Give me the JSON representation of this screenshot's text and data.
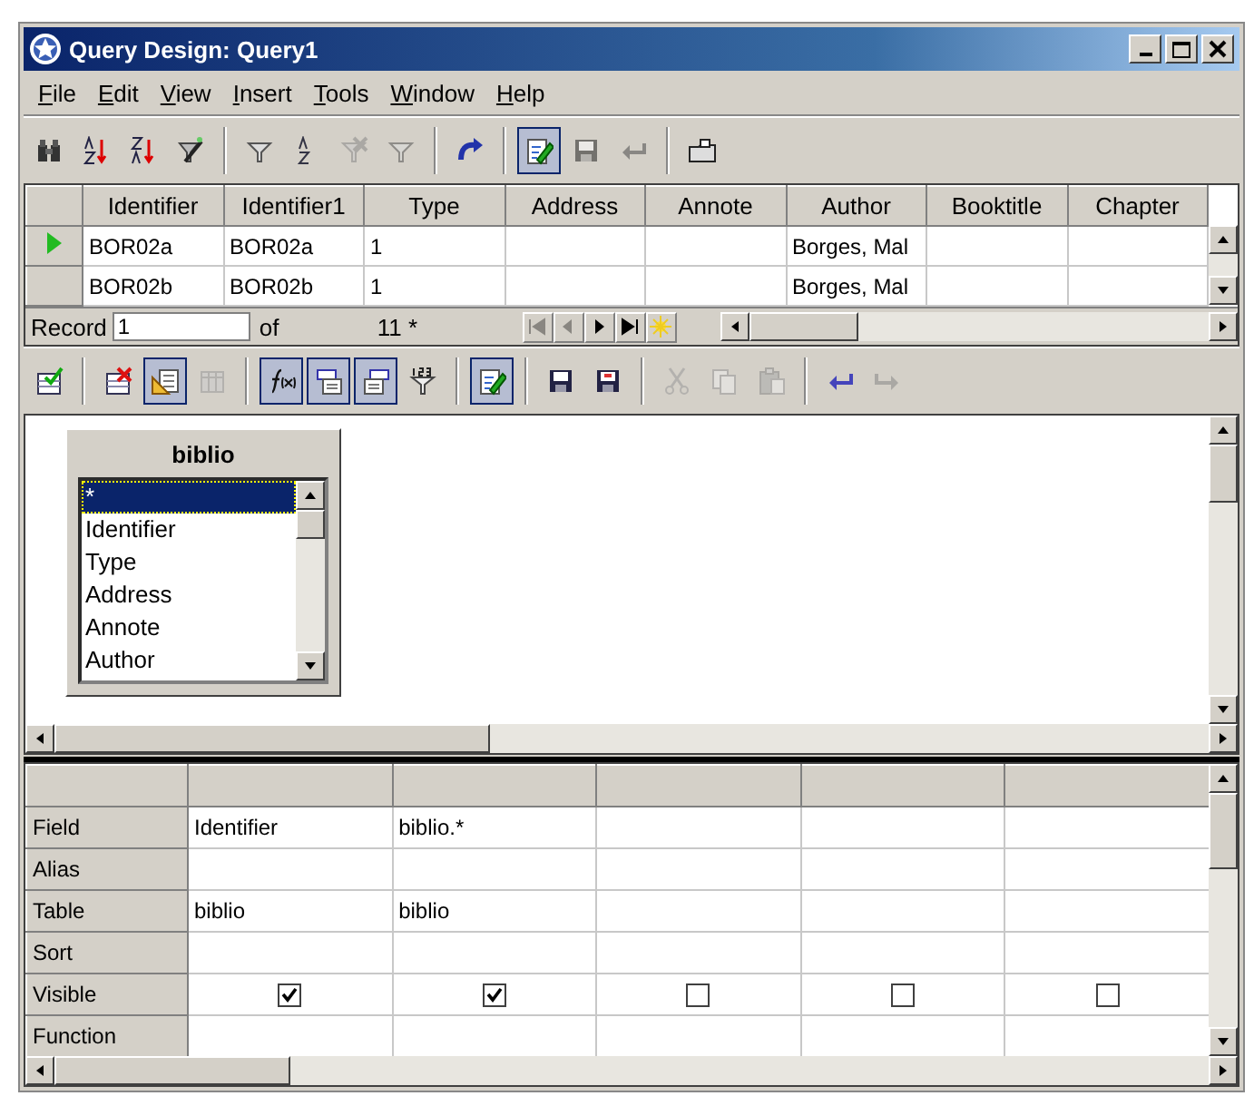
{
  "window": {
    "title": "Query Design: Query1"
  },
  "menu": [
    "File",
    "Edit",
    "View",
    "Insert",
    "Tools",
    "Window",
    "Help"
  ],
  "toolbar": [
    {
      "kind": "find",
      "pressed": false,
      "disabled": false
    },
    {
      "kind": "sort-ascending",
      "pressed": false,
      "disabled": false
    },
    {
      "kind": "sort-descending",
      "pressed": false,
      "disabled": false
    },
    {
      "kind": "auto-filter",
      "pressed": false,
      "disabled": false
    },
    {
      "kind": "separator"
    },
    {
      "kind": "filter",
      "pressed": false,
      "disabled": false
    },
    {
      "kind": "sort",
      "pressed": false,
      "disabled": false
    },
    {
      "kind": "remove-filter",
      "pressed": false,
      "disabled": true
    },
    {
      "kind": "filter",
      "pressed": false,
      "disabled": true
    },
    {
      "kind": "separator"
    },
    {
      "kind": "refresh",
      "pressed": false,
      "disabled": false
    },
    {
      "kind": "separator"
    },
    {
      "kind": "edit",
      "pressed": true,
      "disabled": false
    },
    {
      "kind": "save",
      "pressed": false,
      "disabled": true
    },
    {
      "kind": "undo",
      "pressed": false,
      "disabled": true
    },
    {
      "kind": "separator"
    },
    {
      "kind": "folder",
      "pressed": false,
      "disabled": false
    }
  ],
  "data_grid": {
    "columns": [
      "Identifier",
      "Identifier1",
      "Type",
      "Address",
      "Annote",
      "Author",
      "Booktitle",
      "Chapter"
    ],
    "rows": [
      {
        "current": true,
        "cells": [
          "BOR02a",
          "BOR02a",
          "1",
          "",
          "",
          "Borges, Mal",
          "",
          ""
        ]
      },
      {
        "current": false,
        "cells": [
          "BOR02b",
          "BOR02b",
          "1",
          "",
          "",
          "Borges, Mal",
          "",
          ""
        ]
      }
    ],
    "record_label": "Record",
    "record_value": "1",
    "of_label": "of",
    "record_count": "11 *",
    "nav": [
      {
        "kind": "first",
        "disabled": true
      },
      {
        "kind": "previous",
        "disabled": true
      },
      {
        "kind": "next",
        "disabled": false
      },
      {
        "kind": "last",
        "disabled": false
      },
      {
        "kind": "new",
        "disabled": false
      }
    ]
  },
  "design_toolbar": [
    {
      "kind": "add-table",
      "pressed": false,
      "disabled": false
    },
    {
      "kind": "separator"
    },
    {
      "kind": "delete-table",
      "pressed": false,
      "disabled": false
    },
    {
      "kind": "design-view",
      "pressed": true,
      "disabled": false
    },
    {
      "kind": "table",
      "pressed": false,
      "disabled": true
    },
    {
      "kind": "separator"
    },
    {
      "kind": "functions",
      "pressed": true,
      "disabled": false
    },
    {
      "kind": "table-name",
      "pressed": true,
      "disabled": false
    },
    {
      "kind": "alias",
      "pressed": true,
      "disabled": false
    },
    {
      "kind": "distinct",
      "pressed": false,
      "disabled": false
    },
    {
      "kind": "separator"
    },
    {
      "kind": "edit",
      "pressed": true,
      "disabled": false
    },
    {
      "kind": "separator"
    },
    {
      "kind": "save",
      "pressed": false,
      "disabled": false
    },
    {
      "kind": "save-as",
      "pressed": false,
      "disabled": false
    },
    {
      "kind": "separator"
    },
    {
      "kind": "cut",
      "pressed": false,
      "disabled": true
    },
    {
      "kind": "copy",
      "pressed": false,
      "disabled": true
    },
    {
      "kind": "paste",
      "pressed": false,
      "disabled": true
    },
    {
      "kind": "separator"
    },
    {
      "kind": "undo",
      "pressed": false,
      "disabled": false
    },
    {
      "kind": "redo",
      "pressed": false,
      "disabled": true
    }
  ],
  "table_window": {
    "title": "biblio",
    "fields": [
      {
        "name": "*",
        "selected": true
      },
      {
        "name": "Identifier",
        "selected": false
      },
      {
        "name": "Type",
        "selected": false
      },
      {
        "name": "Address",
        "selected": false
      },
      {
        "name": "Annote",
        "selected": false
      },
      {
        "name": "Author",
        "selected": false
      }
    ]
  },
  "criteria_grid": {
    "row_labels": [
      "Field",
      "Alias",
      "Table",
      "Sort",
      "Visible",
      "Function"
    ],
    "columns": [
      {
        "field": "Identifier",
        "table": "biblio",
        "visible": true
      },
      {
        "field": "biblio.*",
        "table": "biblio",
        "visible": true
      },
      {
        "visible": false
      },
      {
        "visible": false
      },
      {
        "visible": false
      }
    ]
  }
}
